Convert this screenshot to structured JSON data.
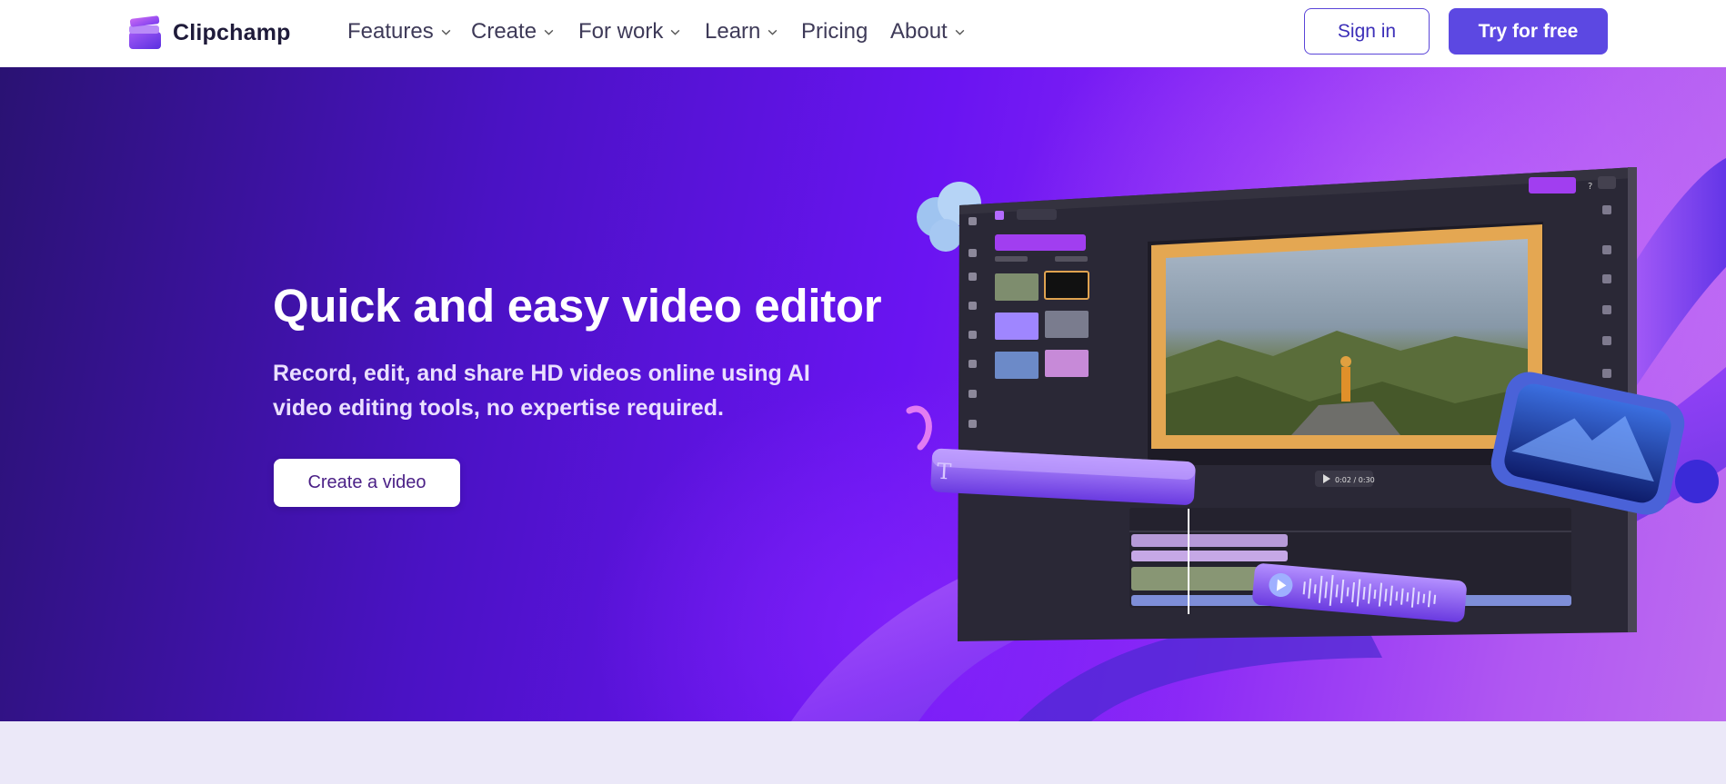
{
  "brand": {
    "name": "Clipchamp"
  },
  "nav": {
    "items": [
      {
        "label": "Features",
        "has_dropdown": true
      },
      {
        "label": "Create",
        "has_dropdown": true
      },
      {
        "label": "For work",
        "has_dropdown": true
      },
      {
        "label": "Learn",
        "has_dropdown": true
      },
      {
        "label": "Pricing",
        "has_dropdown": false
      },
      {
        "label": "About",
        "has_dropdown": true
      }
    ],
    "sign_in_label": "Sign in",
    "try_free_label": "Try for free"
  },
  "hero": {
    "title": "Quick and easy video editor",
    "subtitle": "Record, edit, and share HD videos online using AI video editing tools, no expertise required.",
    "cta_label": "Create a video",
    "preview": {
      "time_display": "0:02 / 0:30"
    }
  },
  "colors": {
    "accent": "#5c48e2",
    "nav_text": "#3e3a58",
    "hero_gradient": [
      "#2a1273",
      "#6a14f2",
      "#bd6cf0"
    ],
    "page_background": "#ebe8f8"
  }
}
